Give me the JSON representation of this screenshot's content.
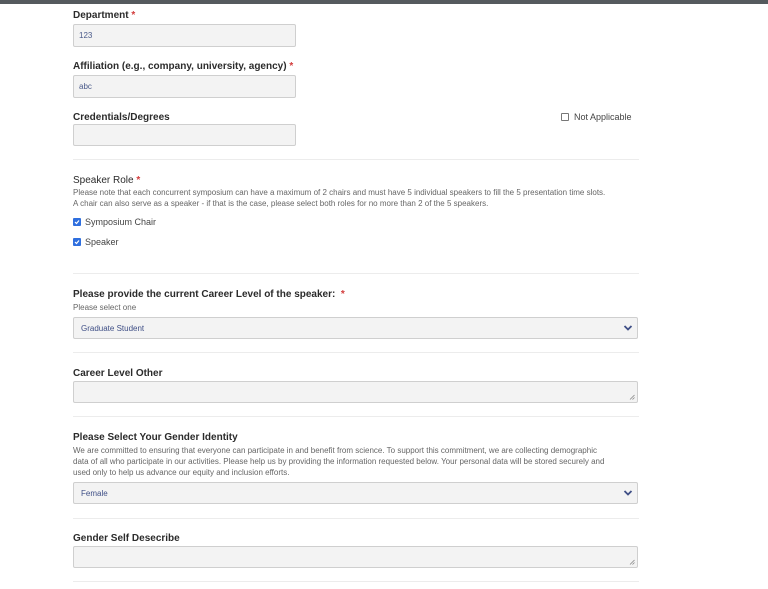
{
  "department": {
    "label": "Department",
    "required_mark": "*",
    "value": "123"
  },
  "affiliation": {
    "label": "Affiliation (e.g., company, university, agency)",
    "required_mark": "*",
    "value": "abc"
  },
  "credentials": {
    "label": "Credentials/Degrees",
    "value": "",
    "not_applicable_label": "Not Applicable",
    "not_applicable_checked": false
  },
  "speaker_role": {
    "label": "Speaker Role",
    "required_mark": "*",
    "help_line1": "Please note that each concurrent symposium can have a maximum of 2 chairs and must have 5 individual speakers to fill the 5 presentation time slots.",
    "help_line2": "A chair can also serve as a speaker - if that is the case, please select both roles for no more than 2 of the 5 speakers.",
    "options": [
      {
        "label": "Symposium Chair",
        "checked": true
      },
      {
        "label": "Speaker",
        "checked": true
      }
    ]
  },
  "career_level": {
    "label": "Please provide the current Career Level of the speaker:",
    "required_mark": "*",
    "help": "Please select one",
    "selected": "Graduate Student"
  },
  "career_level_other": {
    "label": "Career Level Other",
    "value": ""
  },
  "gender_identity": {
    "label": "Please Select Your Gender Identity",
    "help_line1": "We are committed to ensuring that everyone can participate in and benefit from science. To support this commitment, we are collecting demographic",
    "help_line2": "data of all who participate in our activities. Please help us by providing the information requested below. Your personal data will be stored securely and",
    "help_line3": "used only to help us advance our equity and inclusion efforts.",
    "selected": "Female"
  },
  "gender_self_describe": {
    "label": "Gender Self Desecribe",
    "value": ""
  },
  "colors": {
    "checkbox_accent": "#2f6fde",
    "required": "#d23c3c",
    "input_bg": "#f3f3f3"
  }
}
